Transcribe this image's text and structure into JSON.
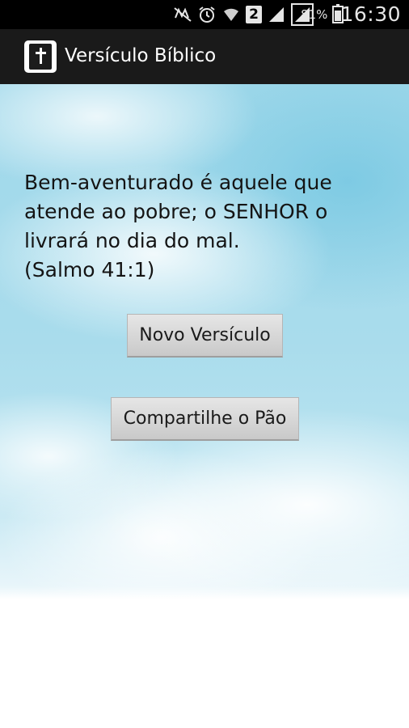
{
  "status_bar": {
    "icons": [
      "mute-icon",
      "alarm-icon",
      "wifi-icon",
      "sim-2-icon",
      "signal-icon",
      "signal-full-icon"
    ],
    "sim_badge": "2",
    "battery_percent": "81%",
    "battery_level": 0.81,
    "time": "16:30"
  },
  "action_bar": {
    "icon": "bible-icon",
    "title": "Versículo Bíblico"
  },
  "main": {
    "verse_text": "Bem-aventurado é aquele que atende ao pobre; o SENHOR o livrará no dia do mal.",
    "verse_reference": "(Salmo 41:1)",
    "new_verse_button": "Novo Versículo",
    "share_button": "Compartilhe o Pão"
  }
}
